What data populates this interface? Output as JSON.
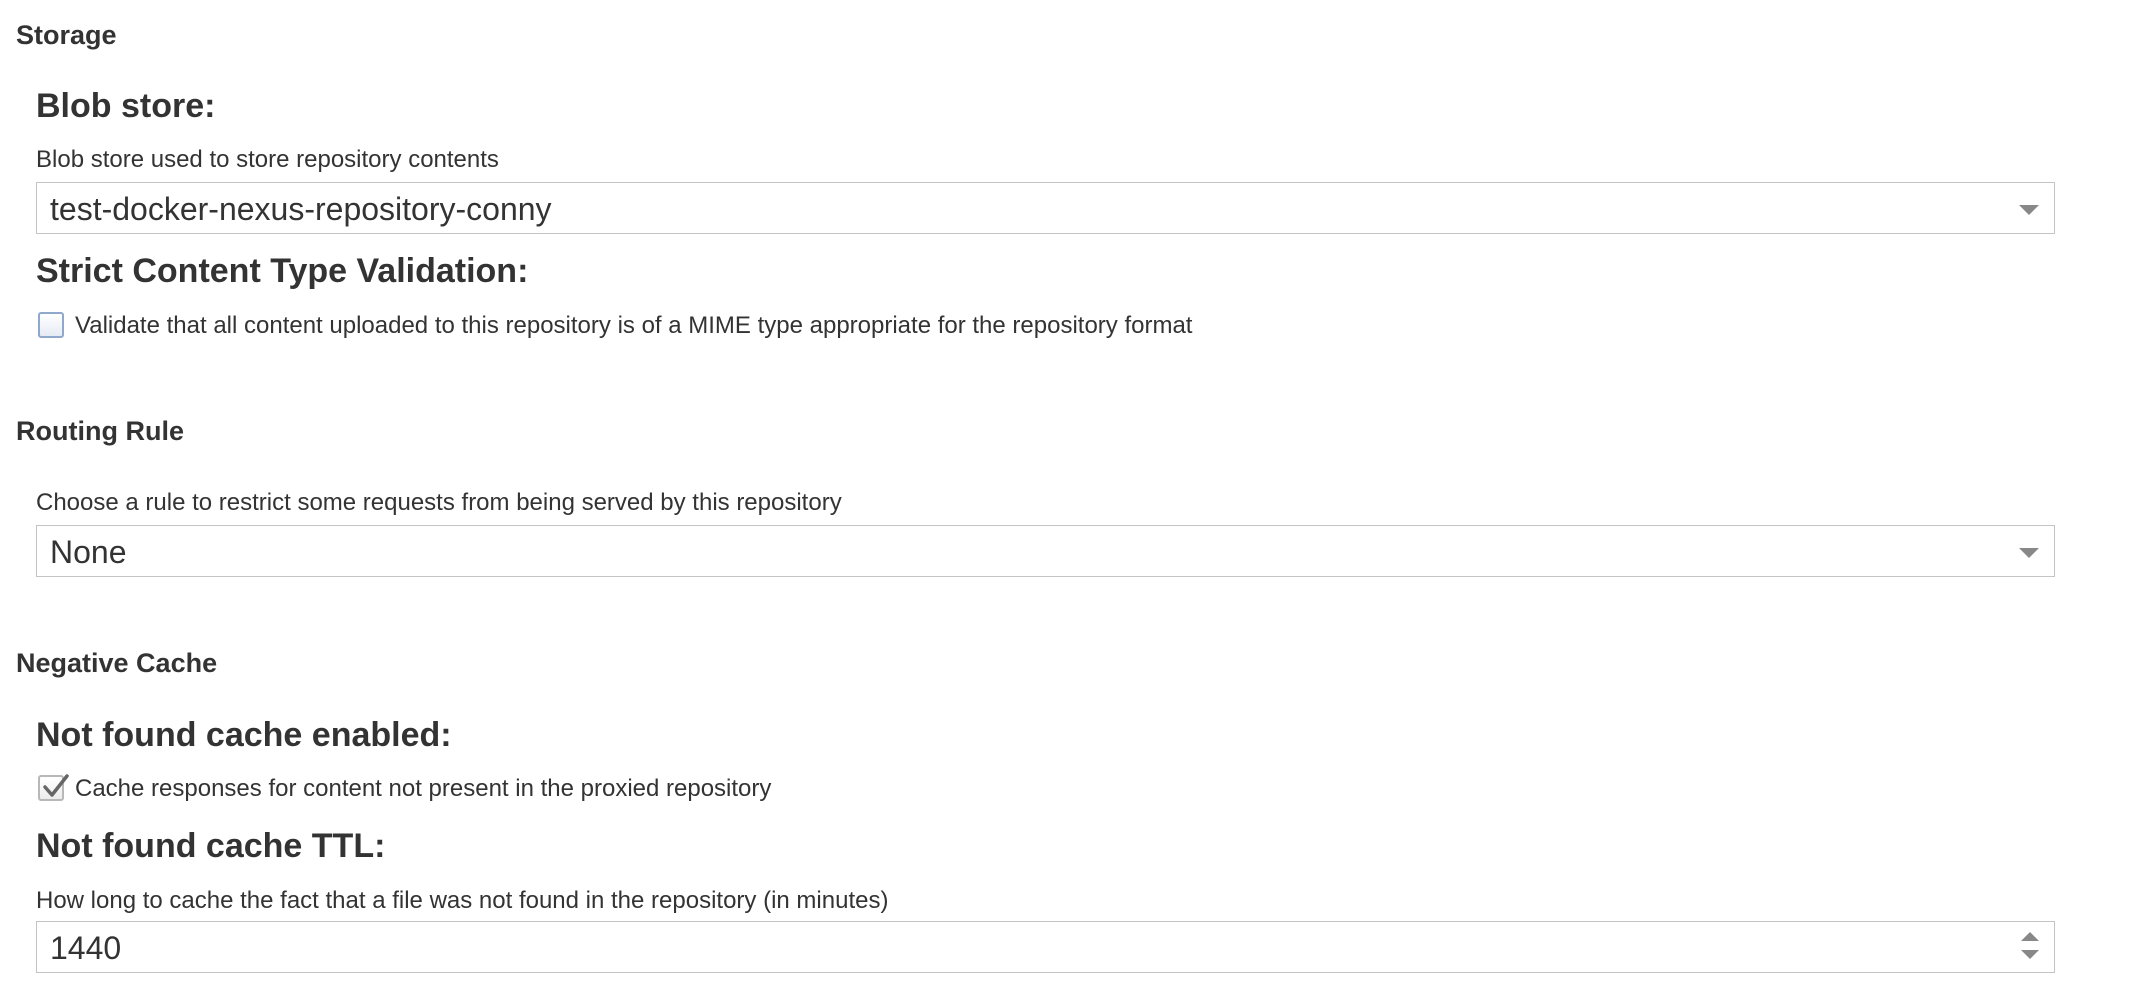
{
  "storage": {
    "section_title": "Storage",
    "blob_store": {
      "label": "Blob store:",
      "help": "Blob store used to store repository contents",
      "value": "test-docker-nexus-repository-conny",
      "icon": "chevron-down-icon"
    },
    "strict_validation": {
      "label": "Strict Content Type Validation:",
      "checkbox_label": "Validate that all content uploaded to this repository is of a MIME type appropriate for the repository format",
      "checked": false
    }
  },
  "routing_rule": {
    "section_title": "Routing Rule",
    "help": "Choose a rule to restrict some requests from being served by this repository",
    "value": "None",
    "icon": "chevron-down-icon"
  },
  "negative_cache": {
    "section_title": "Negative Cache",
    "enabled": {
      "label": "Not found cache enabled:",
      "checkbox_label": "Cache responses for content not present in the proxied repository",
      "checked": true,
      "icon": "checkmark-icon"
    },
    "ttl": {
      "label": "Not found cache TTL:",
      "help": "How long to cache the fact that a file was not found in the repository (in minutes)",
      "value": "1440",
      "icons": [
        "spinner-up-icon",
        "spinner-down-icon"
      ]
    }
  },
  "colors": {
    "text": "#333333",
    "border": "#c4c4c4",
    "caret": "#888888",
    "checkbox_border": "#8fa8cc"
  }
}
